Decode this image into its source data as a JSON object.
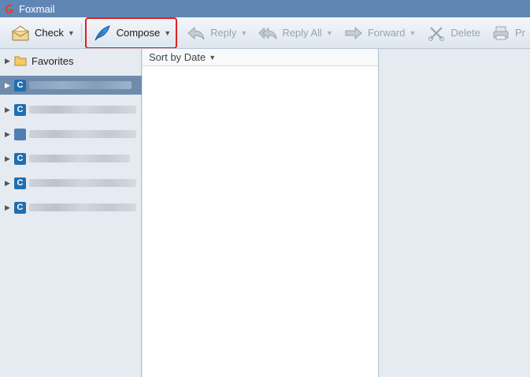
{
  "app": {
    "title": "Foxmail"
  },
  "toolbar": {
    "check_label": "Check",
    "compose_label": "Compose",
    "reply_label": "Reply",
    "reply_all_label": "Reply All",
    "forward_label": "Forward",
    "delete_label": "Delete",
    "print_label": "Pr"
  },
  "sidebar": {
    "favorites_label": "Favorites",
    "account_icon_letter": "C"
  },
  "maillist": {
    "sort_label": "Sort by Date"
  },
  "colors": {
    "titlebar": "#5f86b5",
    "selected_row": "#6f8cad",
    "highlight_outline": "#e02020",
    "account_icon": "#1f6fb0"
  }
}
